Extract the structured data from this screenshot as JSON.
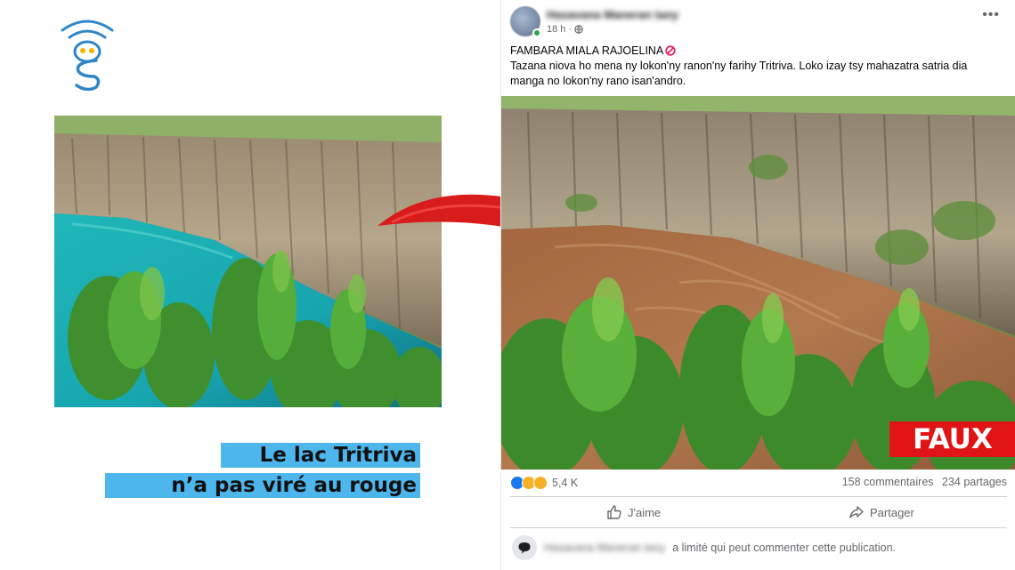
{
  "brand": {
    "logo_icon": "signal-owl-s-logo",
    "accent": "#2f86c8"
  },
  "left": {
    "photo_icon": "lake-turquoise-photo",
    "headline_line1": "Le lac Tritriva",
    "headline_line2": "n’a pas viré au rouge",
    "highlight_color": "#4db6ec"
  },
  "arrow": {
    "icon": "red-curved-arrow-icon",
    "color": "#d81b1b"
  },
  "post": {
    "author": "Hasavana Maneran tany",
    "time": "18 h ·",
    "privacy_icon": "globe-icon",
    "more_label": "•••",
    "text_line1": "FAMBARA MIALA RAJOELINA",
    "text_body": "Tazana niova ho mena ny lokon'ny ranon'ny farihy Tritriva. Loko izay tsy mahazatra satria dia manga no lokon'ny rano isan'andro.",
    "photo_icon": "lake-brown-photo",
    "stamp": "FAUX",
    "stamp_color": "#e01414",
    "reaction_count": "5,4 K",
    "comments": "158 commentaires",
    "shares": "234 partages",
    "like_label": "J'aime",
    "share_label": "Partager",
    "restricted_name": "Hasavana Maneran tany",
    "restricted_text": "a limité qui peut commenter cette publication."
  }
}
